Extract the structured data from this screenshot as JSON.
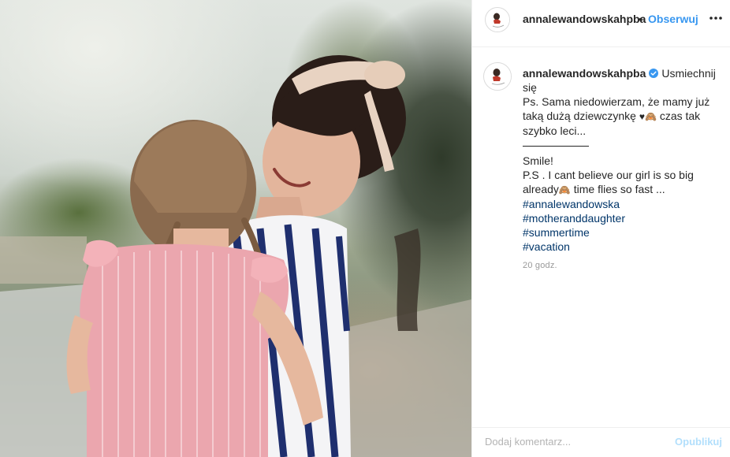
{
  "post": {
    "image_alt": "Photo of a woman with a headband carrying a little girl",
    "header": {
      "username": "annalewandowskahpba",
      "separator": "•",
      "follow_label": "Obserwuj",
      "more_icon": "more-options-icon"
    },
    "caption": {
      "username": "annalewandowskahpba",
      "verified_icon": "verified-badge-icon",
      "first_line": "Usmiechnij się",
      "line2": "Ps. Sama niedowierzam, że mamy już taką dużą dziewczynkę",
      "line2_tail": "czas tak szybko leci...",
      "smile": "Smile!",
      "line_en": "P.S . I cant believe our girl is so big already",
      "line_en_tail": "time flies so fast ...",
      "hashtags": [
        "#annalewandowska",
        "#motheranddaughter",
        "#summertime",
        "#vacation"
      ]
    },
    "timestamp": "20 godz.",
    "comment": {
      "placeholder": "Dodaj komentarz...",
      "publish_label": "Opublikuj"
    }
  },
  "colors": {
    "link_blue": "#3897f0",
    "hashtag": "#003569",
    "timestamp": "#999999",
    "text": "#262626"
  }
}
